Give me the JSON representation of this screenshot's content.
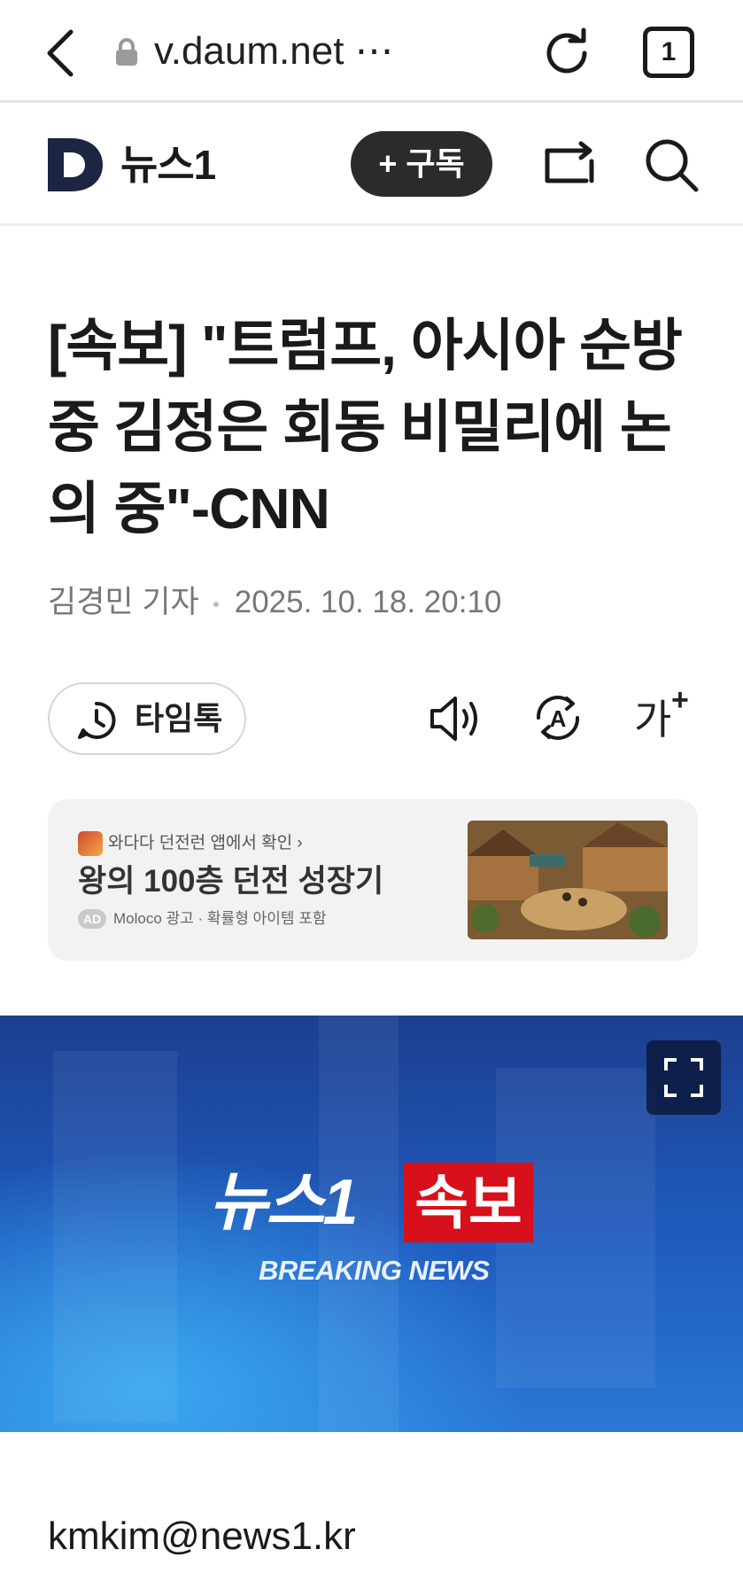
{
  "browser": {
    "url": "v.daum.net ⋯",
    "tab_count": "1"
  },
  "header": {
    "brand": "뉴스1",
    "subscribe_label": "+ 구독"
  },
  "article": {
    "headline": "[속보] \"트럼프, 아시아 순방 중 김정은 회동 비밀리에 논의 중\"-CNN",
    "author": "김경민 기자",
    "datetime": "2025. 10. 18. 20:10",
    "timetalk_label": "타임톡",
    "fontsize_label": "가",
    "fontsize_plus": "+",
    "hero": {
      "brand_text": "뉴스1",
      "breaking_label": "속보",
      "breaking_en": "BREAKING NEWS"
    },
    "email": "kmkim@news1.kr"
  },
  "ad": {
    "source": "와다다 던전런 앱에서 확인 ›",
    "title": "왕의 100층 던전 성장기",
    "badge": "AD",
    "sponsor": "Moloco 광고 · 확률형 아이템 포함"
  },
  "colors": {
    "subscribe_bg": "#2b2b2b",
    "breaking_red": "#d7101b",
    "hero_blue": "#1f5cc0",
    "logo_navy": "#1c2541"
  }
}
